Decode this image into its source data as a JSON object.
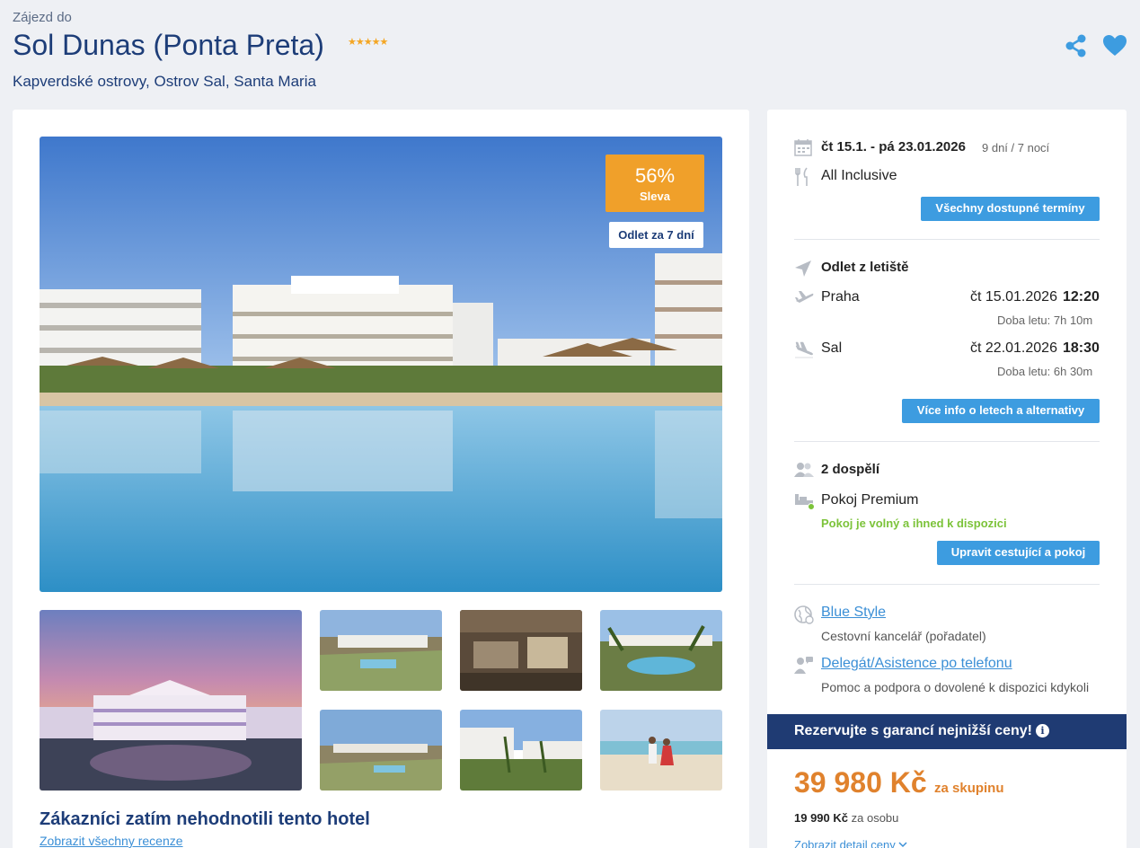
{
  "header": {
    "pretitle": "Zájezd do",
    "hotel_name": "Sol Dunas (Ponta Preta)",
    "stars": "★★★★★",
    "location": "Kapverdské ostrovy, Ostrov Sal, Santa Maria"
  },
  "gallery": {
    "discount_pct": "56%",
    "discount_label": "Sleva",
    "departure_badge": "Odlet za 7 dní"
  },
  "reviews": {
    "title": "Zákazníci zatím nehodnotili tento hotel",
    "link": "Zobrazit všechny recenze"
  },
  "trip": {
    "dates": "čt 15.1. - pá 23.01.2026",
    "duration": "9 dní / 7 nocí",
    "board": "All Inclusive",
    "all_dates_button": "Všechny dostupné termíny"
  },
  "flights": {
    "heading": "Odlet z letiště",
    "outbound": {
      "city": "Praha",
      "date": "čt 15.01.2026",
      "time": "12:20",
      "duration": "Doba letu: 7h 10m"
    },
    "inbound": {
      "city": "Sal",
      "date": "čt 22.01.2026",
      "time": "18:30",
      "duration": "Doba letu: 6h 30m"
    },
    "more_button": "Více info o letech a alternativy"
  },
  "room": {
    "travellers": "2 dospělí",
    "room_name": "Pokoj Premium",
    "availability": "Pokoj je volný a ihned k dispozici",
    "edit_button": "Upravit cestující a pokoj"
  },
  "agency": {
    "name": "Blue Style",
    "role": "Cestovní kancelář (pořadatel)",
    "support_link": "Delegát/Asistence po telefonu",
    "support_text": "Pomoc a podpora o dovolené k dispozici kdykoli"
  },
  "booking": {
    "banner": "Rezervujte s garancí nejnižší ceny!",
    "info_icon": "i",
    "price": "39 980 Kč",
    "price_unit": "za skupinu",
    "per_person_price": "19 990 Kč",
    "per_person_label": "za osobu",
    "detail_link": "Zobrazit detail ceny"
  },
  "colors": {
    "brand_dark": "#1d3d78",
    "accent_blue": "#3d9ce0",
    "discount_orange": "#f0a02a",
    "price_orange": "#e0822d",
    "available_green": "#7cc33a"
  }
}
